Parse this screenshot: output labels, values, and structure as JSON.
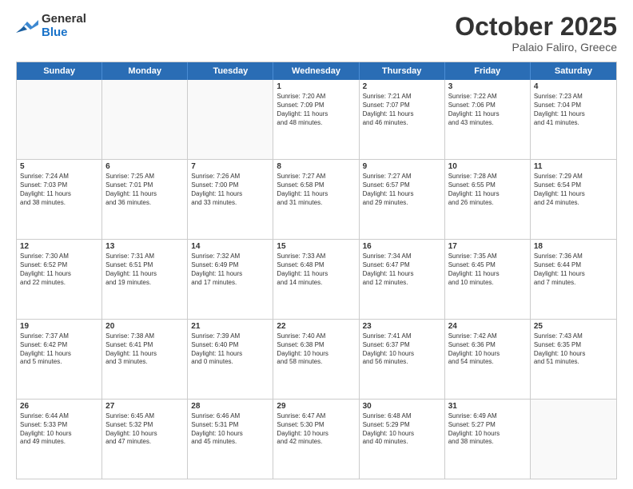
{
  "header": {
    "logo_line1": "General",
    "logo_line2": "Blue",
    "month": "October 2025",
    "location": "Palaio Faliro, Greece"
  },
  "days_of_week": [
    "Sunday",
    "Monday",
    "Tuesday",
    "Wednesday",
    "Thursday",
    "Friday",
    "Saturday"
  ],
  "rows": [
    [
      {
        "day": "",
        "info": ""
      },
      {
        "day": "",
        "info": ""
      },
      {
        "day": "",
        "info": ""
      },
      {
        "day": "1",
        "info": "Sunrise: 7:20 AM\nSunset: 7:09 PM\nDaylight: 11 hours\nand 48 minutes."
      },
      {
        "day": "2",
        "info": "Sunrise: 7:21 AM\nSunset: 7:07 PM\nDaylight: 11 hours\nand 46 minutes."
      },
      {
        "day": "3",
        "info": "Sunrise: 7:22 AM\nSunset: 7:06 PM\nDaylight: 11 hours\nand 43 minutes."
      },
      {
        "day": "4",
        "info": "Sunrise: 7:23 AM\nSunset: 7:04 PM\nDaylight: 11 hours\nand 41 minutes."
      }
    ],
    [
      {
        "day": "5",
        "info": "Sunrise: 7:24 AM\nSunset: 7:03 PM\nDaylight: 11 hours\nand 38 minutes."
      },
      {
        "day": "6",
        "info": "Sunrise: 7:25 AM\nSunset: 7:01 PM\nDaylight: 11 hours\nand 36 minutes."
      },
      {
        "day": "7",
        "info": "Sunrise: 7:26 AM\nSunset: 7:00 PM\nDaylight: 11 hours\nand 33 minutes."
      },
      {
        "day": "8",
        "info": "Sunrise: 7:27 AM\nSunset: 6:58 PM\nDaylight: 11 hours\nand 31 minutes."
      },
      {
        "day": "9",
        "info": "Sunrise: 7:27 AM\nSunset: 6:57 PM\nDaylight: 11 hours\nand 29 minutes."
      },
      {
        "day": "10",
        "info": "Sunrise: 7:28 AM\nSunset: 6:55 PM\nDaylight: 11 hours\nand 26 minutes."
      },
      {
        "day": "11",
        "info": "Sunrise: 7:29 AM\nSunset: 6:54 PM\nDaylight: 11 hours\nand 24 minutes."
      }
    ],
    [
      {
        "day": "12",
        "info": "Sunrise: 7:30 AM\nSunset: 6:52 PM\nDaylight: 11 hours\nand 22 minutes."
      },
      {
        "day": "13",
        "info": "Sunrise: 7:31 AM\nSunset: 6:51 PM\nDaylight: 11 hours\nand 19 minutes."
      },
      {
        "day": "14",
        "info": "Sunrise: 7:32 AM\nSunset: 6:49 PM\nDaylight: 11 hours\nand 17 minutes."
      },
      {
        "day": "15",
        "info": "Sunrise: 7:33 AM\nSunset: 6:48 PM\nDaylight: 11 hours\nand 14 minutes."
      },
      {
        "day": "16",
        "info": "Sunrise: 7:34 AM\nSunset: 6:47 PM\nDaylight: 11 hours\nand 12 minutes."
      },
      {
        "day": "17",
        "info": "Sunrise: 7:35 AM\nSunset: 6:45 PM\nDaylight: 11 hours\nand 10 minutes."
      },
      {
        "day": "18",
        "info": "Sunrise: 7:36 AM\nSunset: 6:44 PM\nDaylight: 11 hours\nand 7 minutes."
      }
    ],
    [
      {
        "day": "19",
        "info": "Sunrise: 7:37 AM\nSunset: 6:42 PM\nDaylight: 11 hours\nand 5 minutes."
      },
      {
        "day": "20",
        "info": "Sunrise: 7:38 AM\nSunset: 6:41 PM\nDaylight: 11 hours\nand 3 minutes."
      },
      {
        "day": "21",
        "info": "Sunrise: 7:39 AM\nSunset: 6:40 PM\nDaylight: 11 hours\nand 0 minutes."
      },
      {
        "day": "22",
        "info": "Sunrise: 7:40 AM\nSunset: 6:38 PM\nDaylight: 10 hours\nand 58 minutes."
      },
      {
        "day": "23",
        "info": "Sunrise: 7:41 AM\nSunset: 6:37 PM\nDaylight: 10 hours\nand 56 minutes."
      },
      {
        "day": "24",
        "info": "Sunrise: 7:42 AM\nSunset: 6:36 PM\nDaylight: 10 hours\nand 54 minutes."
      },
      {
        "day": "25",
        "info": "Sunrise: 7:43 AM\nSunset: 6:35 PM\nDaylight: 10 hours\nand 51 minutes."
      }
    ],
    [
      {
        "day": "26",
        "info": "Sunrise: 6:44 AM\nSunset: 5:33 PM\nDaylight: 10 hours\nand 49 minutes."
      },
      {
        "day": "27",
        "info": "Sunrise: 6:45 AM\nSunset: 5:32 PM\nDaylight: 10 hours\nand 47 minutes."
      },
      {
        "day": "28",
        "info": "Sunrise: 6:46 AM\nSunset: 5:31 PM\nDaylight: 10 hours\nand 45 minutes."
      },
      {
        "day": "29",
        "info": "Sunrise: 6:47 AM\nSunset: 5:30 PM\nDaylight: 10 hours\nand 42 minutes."
      },
      {
        "day": "30",
        "info": "Sunrise: 6:48 AM\nSunset: 5:29 PM\nDaylight: 10 hours\nand 40 minutes."
      },
      {
        "day": "31",
        "info": "Sunrise: 6:49 AM\nSunset: 5:27 PM\nDaylight: 10 hours\nand 38 minutes."
      },
      {
        "day": "",
        "info": ""
      }
    ]
  ]
}
